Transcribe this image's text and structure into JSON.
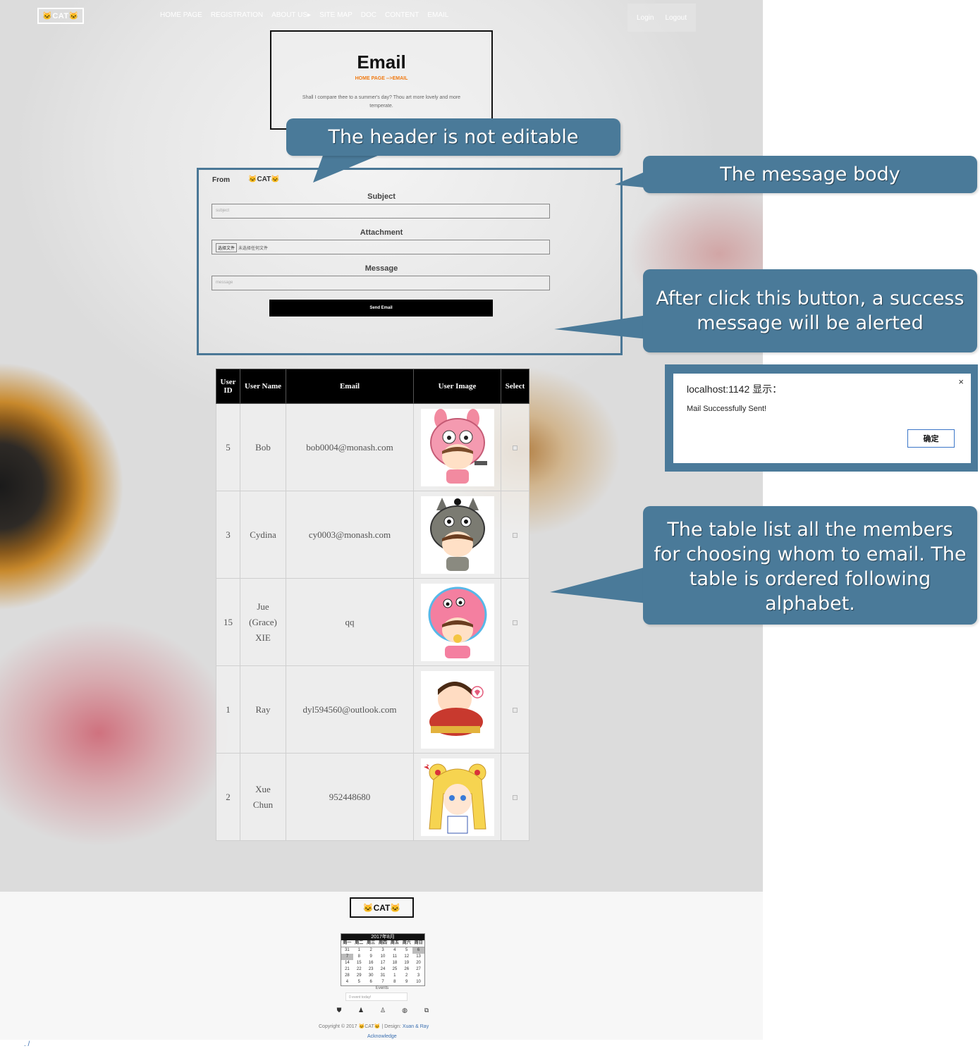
{
  "nav": {
    "logo": "🐱CAT🐱",
    "items": [
      "HOME PAGE",
      "REGISTRATION",
      "ABOUT US▸",
      "SITE MAP",
      "DOC",
      "CONTENT",
      "EMAIL"
    ],
    "login": "Login",
    "logout": "Logout"
  },
  "hero": {
    "title": "Email",
    "breadcrumb": "HOME PAGE  -->EMAIL",
    "quote": "Shall I compare thee to a summer's day? Thou art more lovely and more temperate."
  },
  "form": {
    "from_label": "From",
    "from_value": "🐱CAT🐱",
    "subject_label": "Subject",
    "subject_placeholder": "subject",
    "attachment_label": "Attachment",
    "file_button": "选择文件",
    "file_none": "未选择任何文件",
    "message_label": "Message",
    "message_placeholder": "message",
    "send_button": "Send Email"
  },
  "table": {
    "headers": [
      "User ID",
      "User Name",
      "Email",
      "User Image",
      "Select"
    ],
    "rows": [
      {
        "id": "5",
        "name": "Bob",
        "email": "bob0004@monash.com",
        "avatar": "pink-bunny-hood-avatar"
      },
      {
        "id": "3",
        "name": "Cydina",
        "email": "cy0003@monash.com",
        "avatar": "totoro-hood-avatar"
      },
      {
        "id": "15",
        "name": "Jue (Grace) XIE",
        "email": "qq",
        "avatar": "pink-octopus-hood-avatar"
      },
      {
        "id": "1",
        "name": "Ray",
        "email": "dyl594560@outlook.com",
        "avatar": "ironman-avatar"
      },
      {
        "id": "2",
        "name": "Xue Chun",
        "email": "952448680",
        "avatar": "sailor-moon-avatar"
      }
    ]
  },
  "callouts": {
    "header": "The header is not editable",
    "body": "The message body",
    "button": "After click this button, a success message will be alerted",
    "table": "The table list all the members for choosing whom to email. The table is ordered following alphabet."
  },
  "alert": {
    "title": "localhost:1142 显示：",
    "message": "Mail Successfully Sent!",
    "ok": "确定",
    "close": "×"
  },
  "footer": {
    "logo": "🐱CAT🐱",
    "calendar": {
      "month": "2017年8月",
      "days_of_week": [
        "周一",
        "周二",
        "周三",
        "周四",
        "周五",
        "周六",
        "周日"
      ],
      "weeks": [
        [
          "31",
          "1",
          "2",
          "3",
          "4",
          "5",
          "6"
        ],
        [
          "7",
          "8",
          "9",
          "10",
          "11",
          "12",
          "13"
        ],
        [
          "14",
          "15",
          "16",
          "17",
          "18",
          "19",
          "20"
        ],
        [
          "21",
          "22",
          "23",
          "24",
          "25",
          "26",
          "27"
        ],
        [
          "28",
          "29",
          "30",
          "31",
          "1",
          "2",
          "3"
        ],
        [
          "4",
          "5",
          "6",
          "7",
          "8",
          "9",
          "10"
        ]
      ],
      "events_label": "Events",
      "events_placeholder": "0 event today!"
    },
    "social_icons": [
      "shield-icon",
      "person-icon",
      "person-icon",
      "github-icon",
      "copy-icon"
    ],
    "copyright_prefix": "Copyright © 2017 🐱CAT🐱 | Design:",
    "designers": "Xuan & Ray",
    "acknowledge": "Acknowledge"
  },
  "colors": {
    "callout": "#4a7a99",
    "accent": "#f07a12",
    "link": "#3a6fb0"
  }
}
